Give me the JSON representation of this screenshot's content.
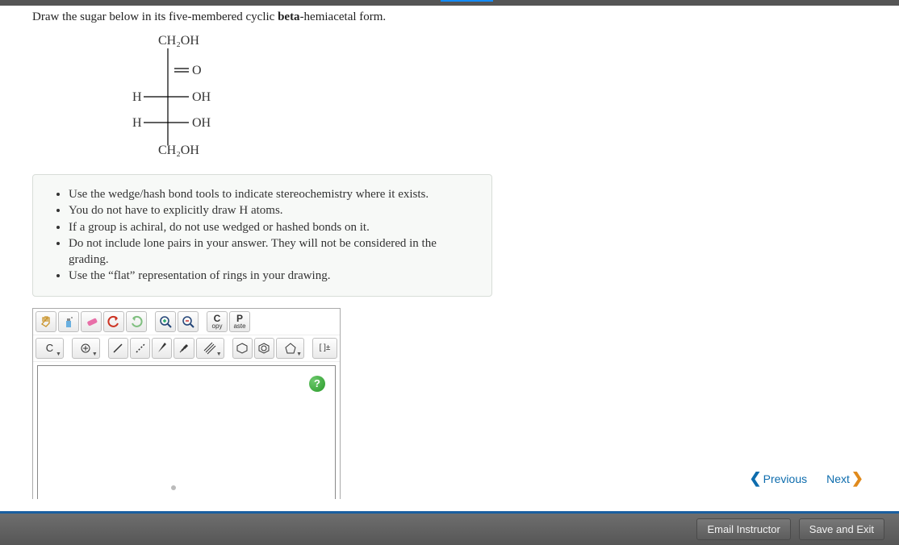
{
  "question": {
    "prefix": "Draw the sugar below in its five-membered cyclic ",
    "bold": "beta",
    "suffix": "-hemiacetal form."
  },
  "fischer": {
    "top": "CH₂OH",
    "r1_right": "O",
    "r2_left": "H",
    "r2_right": "OH",
    "r3_left": "H",
    "r3_right": "OH",
    "bottom": "CH₂OH"
  },
  "hints": [
    "Use the wedge/hash bond tools to indicate stereochemistry where it exists.",
    "You do not have to explicitly draw H atoms.",
    "If a group is achiral, do not use wedged or hashed bonds on it.",
    "Do not include lone pairs in your answer. They will not be considered in the grading.",
    "Use the “flat” representation of rings in your drawing."
  ],
  "toolbar": {
    "copy_big": "C",
    "copy_small": "opy",
    "paste_big": "P",
    "paste_small": "aste",
    "atom": "C",
    "bracket": "[ ]±",
    "help": "?"
  },
  "nav": {
    "prev": "Previous",
    "next": "Next"
  },
  "footer": {
    "email": "Email Instructor",
    "save": "Save and Exit"
  }
}
